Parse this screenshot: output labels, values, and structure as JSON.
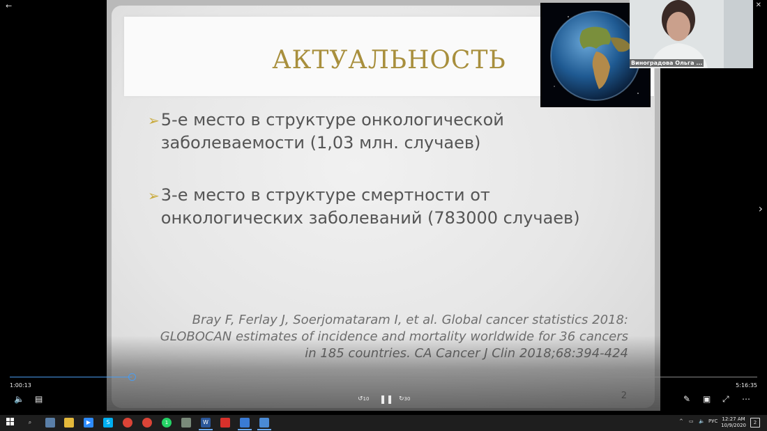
{
  "slide": {
    "title": "АКТУАЛЬНОСТЬ",
    "bullets": [
      "5-е место в структуре онкологической заболеваемости (1,03 млн. случаев)",
      "3-е место в структуре смертности от онкологических заболеваний (783000 случаев)"
    ],
    "bullet_marker": "➢",
    "citation": "Bray F, Ferlay J, Soerjomataram I, et al. Global cancer statistics 2018: GLOBOCAN estimates of incidence and mortality worldwide for 36 cancers in 185 countries. CA Cancer J Clin 2018;68:394-424",
    "page_number": "2"
  },
  "player": {
    "current_time": "1:00:13",
    "total_time": "5:16:35",
    "progress_fraction": 0.163,
    "rewind_label": "10",
    "forward_label": "30"
  },
  "participants": {
    "speaker_name": "Виноградова Ольга ..."
  },
  "taskbar": {
    "language": "РУС",
    "time": "12:27 AM",
    "date": "10/9/2020",
    "notification_count": "2",
    "whatsapp_badge": "1"
  },
  "colors": {
    "title": "#a88f3d",
    "bullet_marker": "#c9aa3b",
    "progress": "#4a9cf0"
  }
}
